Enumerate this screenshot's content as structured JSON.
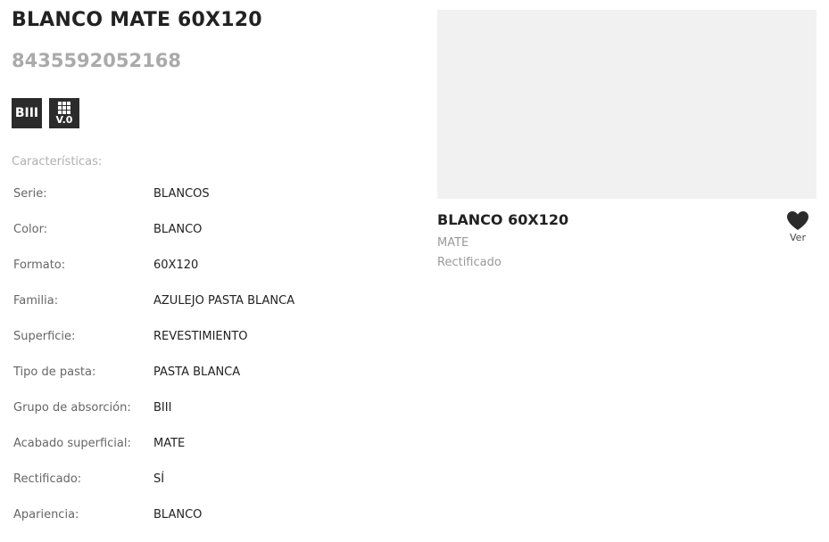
{
  "product": {
    "title": "BLANCO MATE 60X120",
    "ean": "8435592052168",
    "badges": {
      "absorption": "BIII",
      "version": "V.0"
    },
    "characteristics_label": "Características:",
    "specs": [
      {
        "key": "Serie:",
        "value": "BLANCOS"
      },
      {
        "key": "Color:",
        "value": "BLANCO"
      },
      {
        "key": "Formato:",
        "value": "60X120"
      },
      {
        "key": "Familia:",
        "value": "AZULEJO PASTA BLANCA"
      },
      {
        "key": "Superficie:",
        "value": "REVESTIMIENTO"
      },
      {
        "key": "Tipo de pasta:",
        "value": "PASTA BLANCA"
      },
      {
        "key": "Grupo de absorción:",
        "value": "BIII"
      },
      {
        "key": "Acabado superficial:",
        "value": "MATE"
      },
      {
        "key": "Rectificado:",
        "value": "SÍ"
      },
      {
        "key": "Apariencia:",
        "value": "BLANCO"
      }
    ]
  },
  "card": {
    "title": "BLANCO 60X120",
    "finish": "MATE",
    "edge": "Rectificado",
    "favorite_label": "Ver",
    "favorite_icon": "heart-icon"
  },
  "colors": {
    "text": "#222222",
    "muted": "#aaaaaa",
    "badge_bg": "#2b2b2b",
    "image_placeholder": "#f1f1f1"
  }
}
